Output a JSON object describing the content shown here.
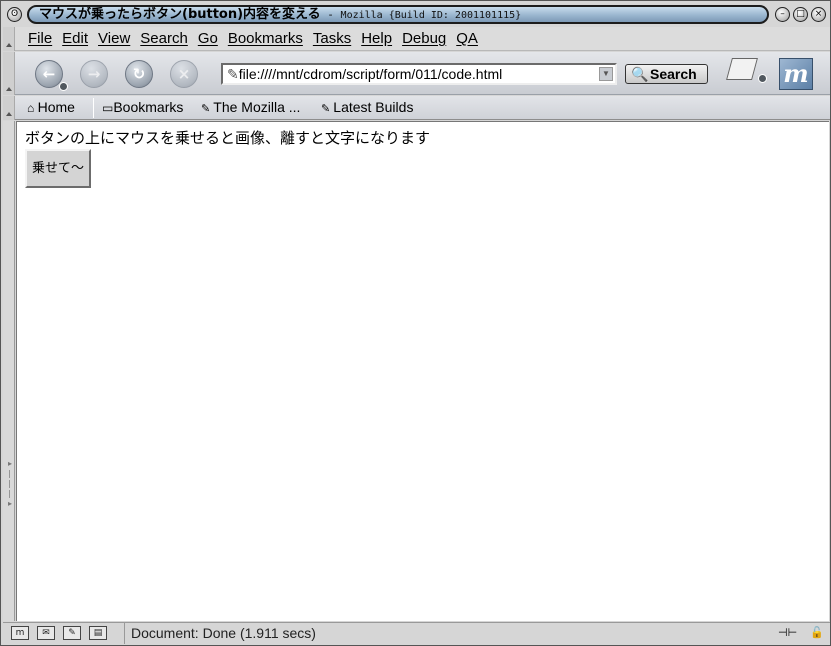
{
  "window": {
    "title_main": "マウスが乗ったらボタン(button)内容を変える",
    "title_separator": " - ",
    "title_app": "Mozilla {Build ID: 2001101115}"
  },
  "menu": {
    "items": [
      "File",
      "Edit",
      "View",
      "Search",
      "Go",
      "Bookmarks",
      "Tasks",
      "Help",
      "Debug",
      "QA"
    ]
  },
  "navbar": {
    "url": "file:////mnt/cdrom/script/form/011/code.html",
    "search_label": "Search"
  },
  "personal_toolbar": {
    "items": [
      "Home",
      "Bookmarks",
      "The Mozilla ...",
      "Latest Builds"
    ]
  },
  "page": {
    "instruction_text": "ボタンの上にマウスを乗せると画像、離すと文字になります",
    "button_label": "乗せて～"
  },
  "status": {
    "text": "Document: Done (1.911 secs)"
  }
}
